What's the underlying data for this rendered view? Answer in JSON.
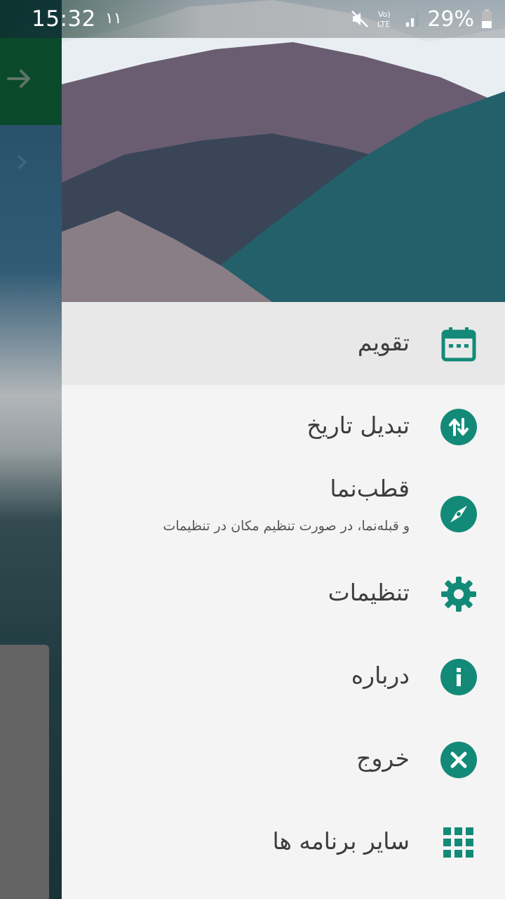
{
  "status_bar": {
    "time": "15:32",
    "carrier_indicator": "١١",
    "network_label": "Vo) LTE",
    "battery_percent": "29%",
    "icons": [
      "mute-icon",
      "lte-icon",
      "signal-icon",
      "battery-icon"
    ]
  },
  "background_app": {
    "back_icon": "arrow-right-icon",
    "toolbar_color": "#0d5a34"
  },
  "drawer": {
    "accent_color": "#138a78",
    "items": [
      {
        "label": "تقویم",
        "icon": "calendar-icon",
        "active": true
      },
      {
        "label": "تبدیل تاریخ",
        "icon": "swap-vertical-icon",
        "active": false
      },
      {
        "label": "قطب‌نما",
        "sublabel": "و قبله‌نما، در صورت تنظیم مکان در تنظیمات",
        "icon": "compass-icon",
        "active": false
      },
      {
        "label": "تنظیمات",
        "icon": "gear-icon",
        "active": false
      },
      {
        "label": "درباره",
        "icon": "info-icon",
        "active": false
      },
      {
        "label": "خروج",
        "icon": "close-circle-icon",
        "active": false
      },
      {
        "label": "سایر برنامه ها",
        "icon": "apps-grid-icon",
        "active": false
      }
    ]
  }
}
